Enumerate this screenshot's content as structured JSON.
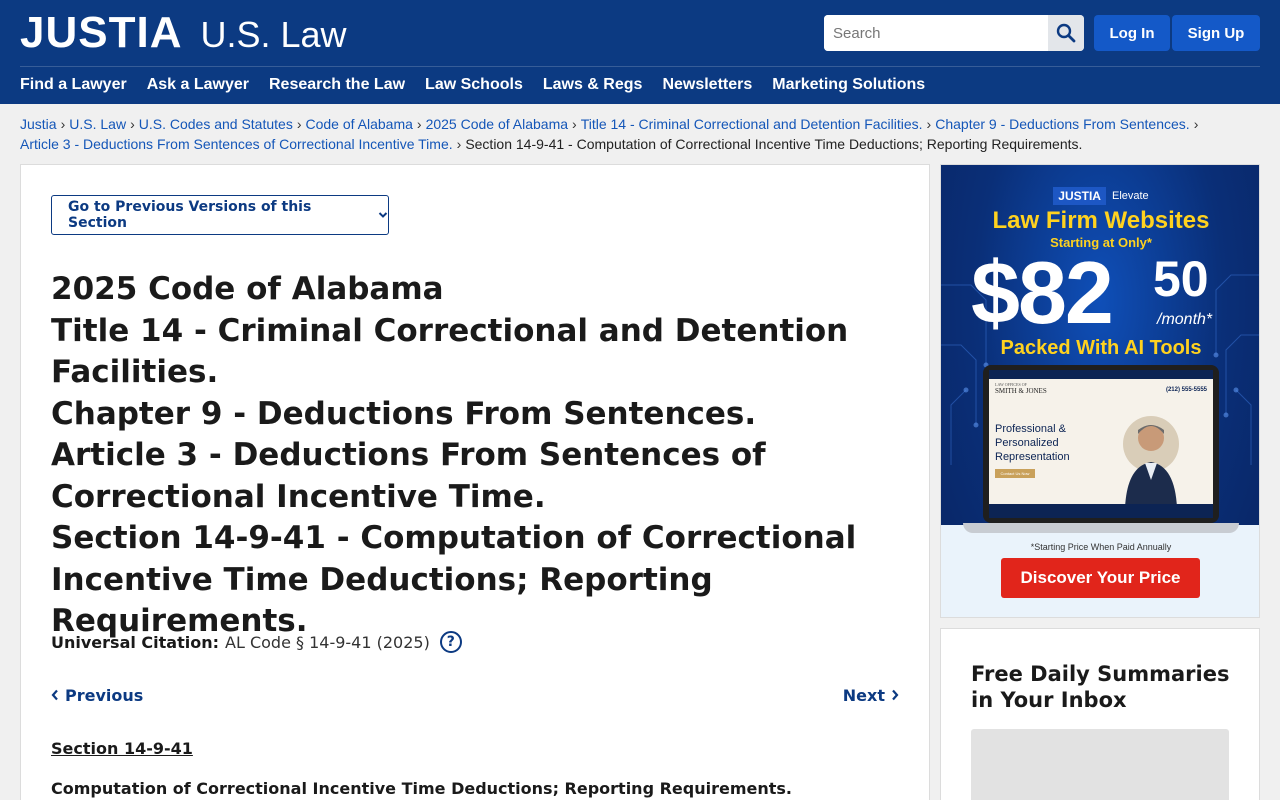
{
  "header": {
    "logo": "JUSTIA",
    "logo_sub": "U.S. Law",
    "search_placeholder": "Search",
    "login_label": "Log In",
    "signup_label": "Sign Up",
    "nav": [
      "Find a Lawyer",
      "Ask a Lawyer",
      "Research the Law",
      "Law Schools",
      "Laws & Regs",
      "Newsletters",
      "Marketing Solutions"
    ]
  },
  "breadcrumb": {
    "links": [
      "Justia",
      "U.S. Law",
      "U.S. Codes and Statutes",
      "Code of Alabama",
      "2025 Code of Alabama",
      "Title 14 - Criminal Correctional and Detention Facilities.",
      "Chapter 9 - Deductions From Sentences.",
      "Article 3 - Deductions From Sentences of Correctional Incentive Time."
    ],
    "separator": "›",
    "current": "Section 14-9-41 - Computation of Correctional Incentive Time Deductions; Reporting Requirements."
  },
  "main": {
    "versions_button": "Go to Previous Versions of this Section",
    "heading_lines": [
      "2025 Code of Alabama",
      "Title 14 - Criminal Correctional and Detention Facilities.",
      "Chapter 9 - Deductions From Sentences.",
      "Article 3 - Deductions From Sentences of Correctional Incentive Time.",
      "Section 14-9-41 - Computation of Correctional Incentive Time Deductions; Reporting Requirements."
    ],
    "citation_label": "Universal Citation:",
    "citation_value": "AL Code § 14-9-41 (2025)",
    "help_icon": "?",
    "prev_label": "Previous",
    "next_label": "Next",
    "section_number": "Section 14-9-41",
    "section_title": "Computation of Correctional Incentive Time Deductions; Reporting Requirements."
  },
  "ad": {
    "brand_logo": "JUSTIA",
    "brand_sub": "Elevate",
    "headline": "Law Firm Websites",
    "starting": "Starting at Only*",
    "price_main": "$82",
    "price_cents": "50",
    "price_unit": "/month*",
    "tools": "Packed With AI Tools",
    "site_firm_small": "LAW OFFICES OF",
    "site_firm": "SMITH & JONES",
    "site_phone": "(212) 555-5555",
    "site_tagline": "Professional & Personalized Representation",
    "site_cta": "Contact Us Now",
    "fine_print": "*Starting Price When Paid Annually",
    "cta": "Discover Your Price"
  },
  "newsletter": {
    "title": "Free Daily Summaries in Your Inbox"
  },
  "colors": {
    "header_bg": "#0c3a82",
    "link": "#1456b8",
    "button_blue": "#1459c8",
    "ad_yellow": "#ffd21f",
    "ad_red": "#e1251b"
  },
  "icons": [
    "search-icon",
    "chevron-down-icon",
    "help-icon",
    "chevron-left-icon",
    "chevron-right-icon"
  ]
}
